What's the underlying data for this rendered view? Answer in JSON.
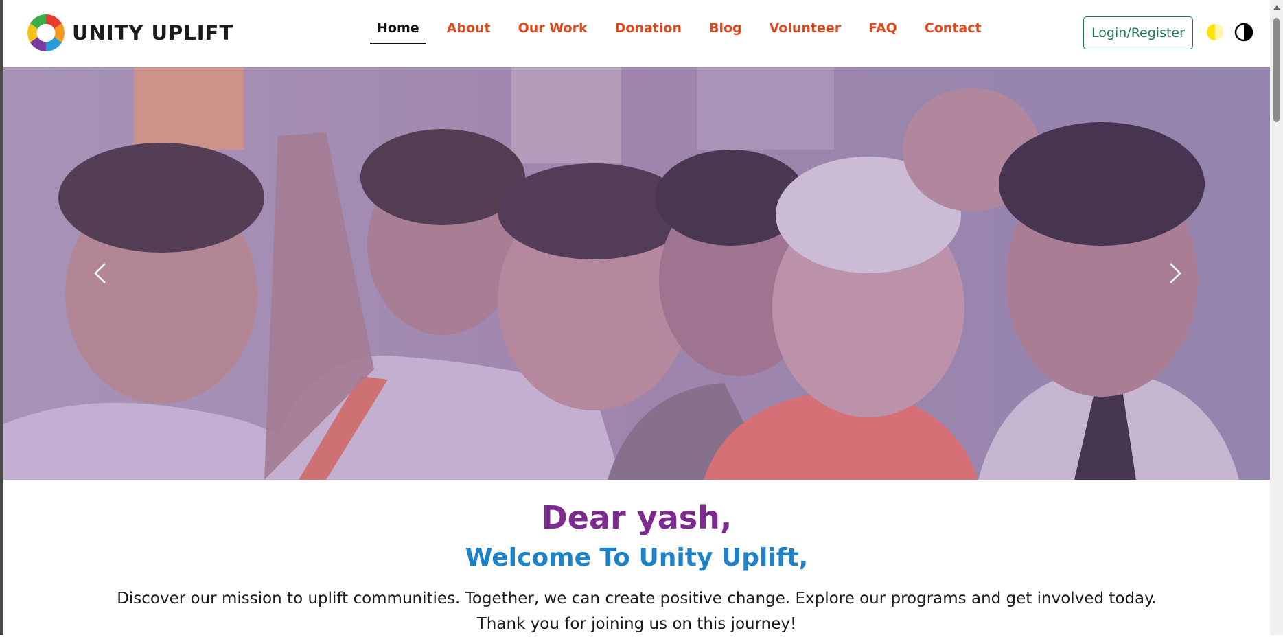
{
  "brand": {
    "name": "UNITY UPLIFT",
    "logo_icon": "unity-uplift-logo"
  },
  "nav": {
    "items": [
      {
        "label": "Home",
        "active": true
      },
      {
        "label": "About",
        "active": false
      },
      {
        "label": "Our Work",
        "active": false
      },
      {
        "label": "Donation",
        "active": false
      },
      {
        "label": "Blog",
        "active": false
      },
      {
        "label": "Volunteer",
        "active": false
      },
      {
        "label": "FAQ",
        "active": false
      },
      {
        "label": "Contact",
        "active": false
      }
    ],
    "active_color": "#111111",
    "link_color": "#e0491d"
  },
  "header": {
    "login_label": "Login/Register",
    "login_color": "#1f7a52",
    "theme_icons": [
      "theme-yellow-icon",
      "contrast-icon"
    ]
  },
  "carousel": {
    "prev_icon": "chevron-left-icon",
    "next_icon": "chevron-right-icon"
  },
  "welcome": {
    "greeting": "Dear yash,",
    "title": "Welcome To Unity Uplift,",
    "intro_line1": "Discover our mission to uplift communities. Together, we can create positive change. Explore our programs and get involved today.",
    "intro_line2": "Thank you for joining us on this journey!",
    "greeting_color": "#7d2a91",
    "title_color": "#1e82c8"
  }
}
